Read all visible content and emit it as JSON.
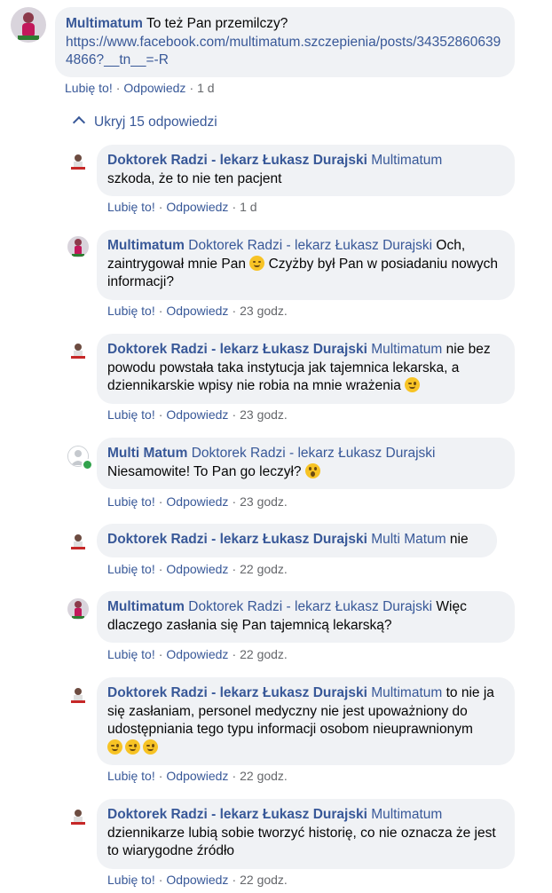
{
  "top_comment": {
    "author": "Multimatum",
    "text": "To też Pan przemilczy?",
    "link": "https://www.facebook.com/multimatum.szczepienia/posts/343528606394866?__tn__=-R",
    "like": "Lubię to!",
    "reply": "Odpowiedz",
    "time": "1 d"
  },
  "toggle_label": "Ukryj 15 odpowiedzi",
  "replies": [
    {
      "author": "Doktorek Radzi - lekarz Łukasz Durajski",
      "mention": "Multimatum",
      "text": "szkoda, że to nie ten pacjent",
      "like": "Lubię to!",
      "reply": "Odpowiedz",
      "time": "1 d"
    },
    {
      "author": "Multimatum",
      "mention": "Doktorek Radzi - lekarz Łukasz Durajski",
      "text_a": "Och, zaintrygował mnie Pan",
      "text_b": "Czyżby był Pan w posiadaniu nowych informacji?",
      "emoji": "blush-icon",
      "like": "Lubię to!",
      "reply": "Odpowiedz",
      "time": "23 godz."
    },
    {
      "author": "Doktorek Radzi - lekarz Łukasz Durajski",
      "mention": "Multimatum",
      "text": "nie bez powodu powstała taka instytucja jak tajemnica lekarska, a dziennikarskie wpisy nie robia na mnie wrażenia",
      "emoji": "wink-icon",
      "like": "Lubię to!",
      "reply": "Odpowiedz",
      "time": "23 godz."
    },
    {
      "author": "Multi Matum",
      "mention": "Doktorek Radzi - lekarz Łukasz Durajski",
      "text": "Niesamowite! To Pan go leczył?",
      "emoji": "surprised-icon",
      "like": "Lubię to!",
      "reply": "Odpowiedz",
      "time": "23 godz."
    },
    {
      "author": "Doktorek Radzi - lekarz Łukasz Durajski",
      "mention": "Multi Matum",
      "text": "nie",
      "like": "Lubię to!",
      "reply": "Odpowiedz",
      "time": "22 godz."
    },
    {
      "author": "Multimatum",
      "mention": "Doktorek Radzi - lekarz Łukasz Durajski",
      "text": "Więc dlaczego zasłania się Pan tajemnicą lekarską?",
      "like": "Lubię to!",
      "reply": "Odpowiedz",
      "time": "22 godz."
    },
    {
      "author": "Doktorek Radzi - lekarz Łukasz Durajski",
      "mention": "Multimatum",
      "text": "to nie ja się zasłaniam, personel medyczny nie jest upoważniony do udostępniania tego typu informacji osobom nieuprawnionym",
      "emoji": "wink-icon",
      "like": "Lubię to!",
      "reply": "Odpowiedz",
      "time": "22 godz."
    },
    {
      "author": "Doktorek Radzi - lekarz Łukasz Durajski",
      "mention": "Multimatum",
      "text": "dziennikarze lubią sobie tworzyć historię, co nie oznacza że jest to wiarygodne źródło",
      "like": "Lubię to!",
      "reply": "Odpowiedz",
      "time": "22 godz."
    }
  ],
  "separator": "·"
}
